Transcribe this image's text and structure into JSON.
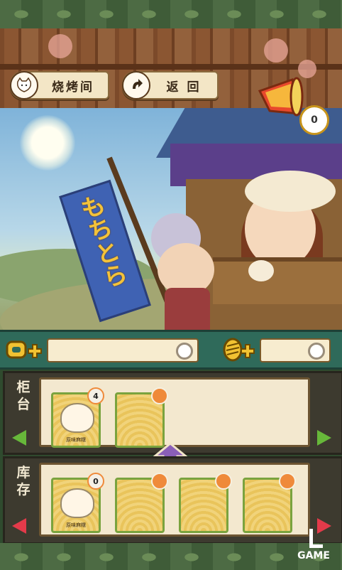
{
  "header": {
    "roast_room_label": "烧烤间",
    "back_label": "返 回"
  },
  "scene": {
    "banner_text": "もちとら",
    "notification_count": "0"
  },
  "currency": {
    "gold_value": "",
    "coin_value": ""
  },
  "counter": {
    "label_line1": "柜",
    "label_line2": "台",
    "slots": [
      {
        "badge": "4",
        "item_name": "原味麻糬",
        "has_item": true
      },
      {
        "badge": "",
        "item_name": "",
        "has_item": false
      }
    ]
  },
  "stock": {
    "label_line1": "库",
    "label_line2": "存",
    "slots": [
      {
        "badge": "0",
        "item_name": "原味麻糬",
        "has_item": true
      },
      {
        "badge": "",
        "item_name": "",
        "has_item": false
      },
      {
        "badge": "",
        "item_name": "",
        "has_item": false
      },
      {
        "badge": "",
        "item_name": "",
        "has_item": false
      }
    ]
  },
  "footer": {
    "brand": "GAME"
  },
  "colors": {
    "accent_green": "#67b83a",
    "accent_red": "#e33a4a",
    "badge_orange": "#ef8a3a"
  }
}
